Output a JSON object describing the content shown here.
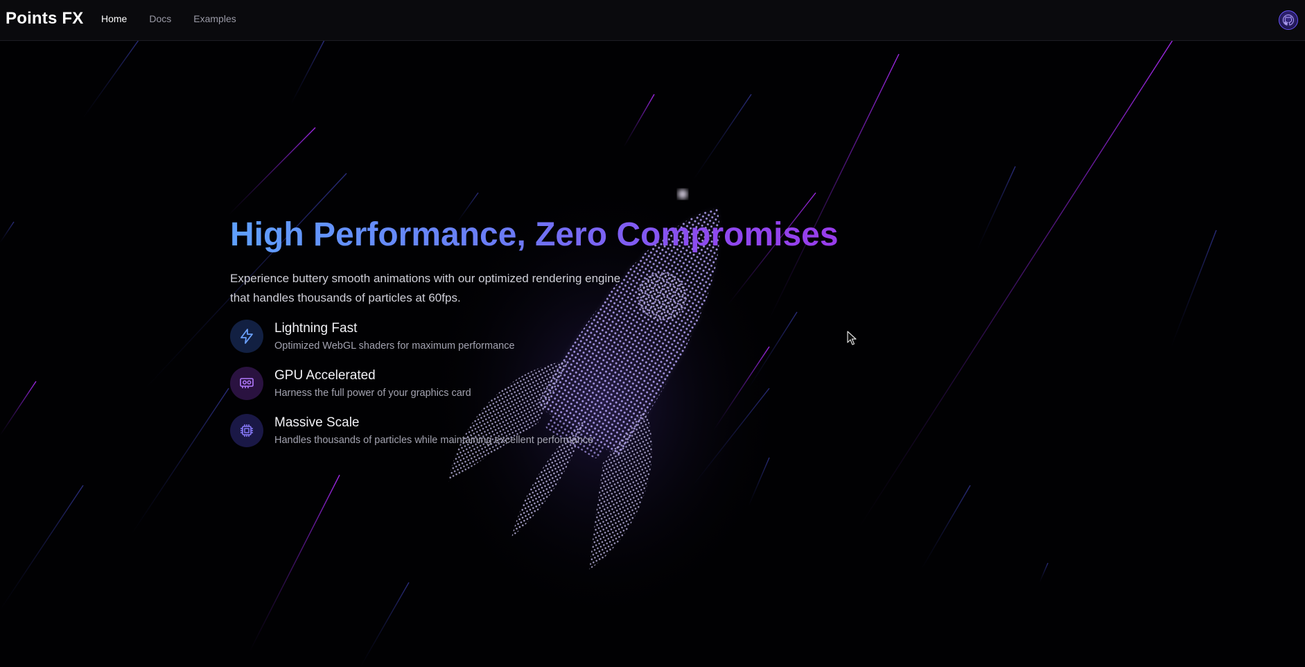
{
  "nav": {
    "brand": "Points FX",
    "links": [
      {
        "label": "Home",
        "active": true
      },
      {
        "label": "Docs",
        "active": false
      },
      {
        "label": "Examples",
        "active": false
      }
    ],
    "github_icon": "github-icon"
  },
  "hero": {
    "title": "High Performance, Zero Compromises",
    "subtitle": "Experience buttery smooth animations with our optimized rendering engine that handles thousands of particles at 60fps.",
    "features": [
      {
        "icon": "lightning-icon",
        "title": "Lightning Fast",
        "description": "Optimized WebGL shaders for maximum performance"
      },
      {
        "icon": "gpu-card-icon",
        "title": "GPU Accelerated",
        "description": "Harness the full power of your graphics card"
      },
      {
        "icon": "cpu-chip-icon",
        "title": "Massive Scale",
        "description": "Handles thousands of particles while maintaining excellent performance"
      }
    ]
  },
  "colors": {
    "background": "#010103",
    "accent_blue": "#5fa0ff",
    "accent_purple": "#9a3bea"
  }
}
